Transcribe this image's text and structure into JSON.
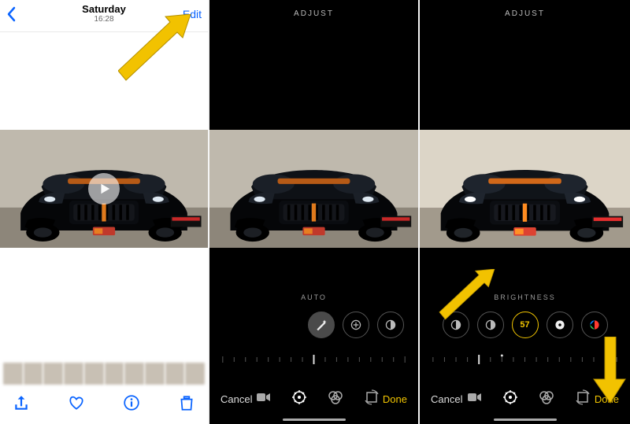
{
  "panel1": {
    "day_label": "Saturday",
    "time_label": "16:28",
    "edit_label": "Edit",
    "toolbar": {
      "share": "share-icon",
      "heart": "heart-icon",
      "info": "info-icon",
      "trash": "trash-icon"
    }
  },
  "panel2": {
    "header": "ADJUST",
    "category": "AUTO",
    "cancel": "Cancel",
    "done": "Done"
  },
  "panel3": {
    "header": "ADJUST",
    "category": "BRIGHTNESS",
    "selected_value": "57",
    "cancel": "Cancel",
    "done": "Done"
  },
  "editor_tabs": [
    "video-icon",
    "adjust-icon",
    "filters-icon",
    "crop-icon"
  ],
  "adjust_dials": [
    "auto-icon",
    "exposure-icon",
    "brilliance-icon",
    "highlights-icon",
    "shadows-icon",
    "contrast-icon",
    "brightness-icon",
    "blackpoint-icon",
    "saturation-icon"
  ]
}
